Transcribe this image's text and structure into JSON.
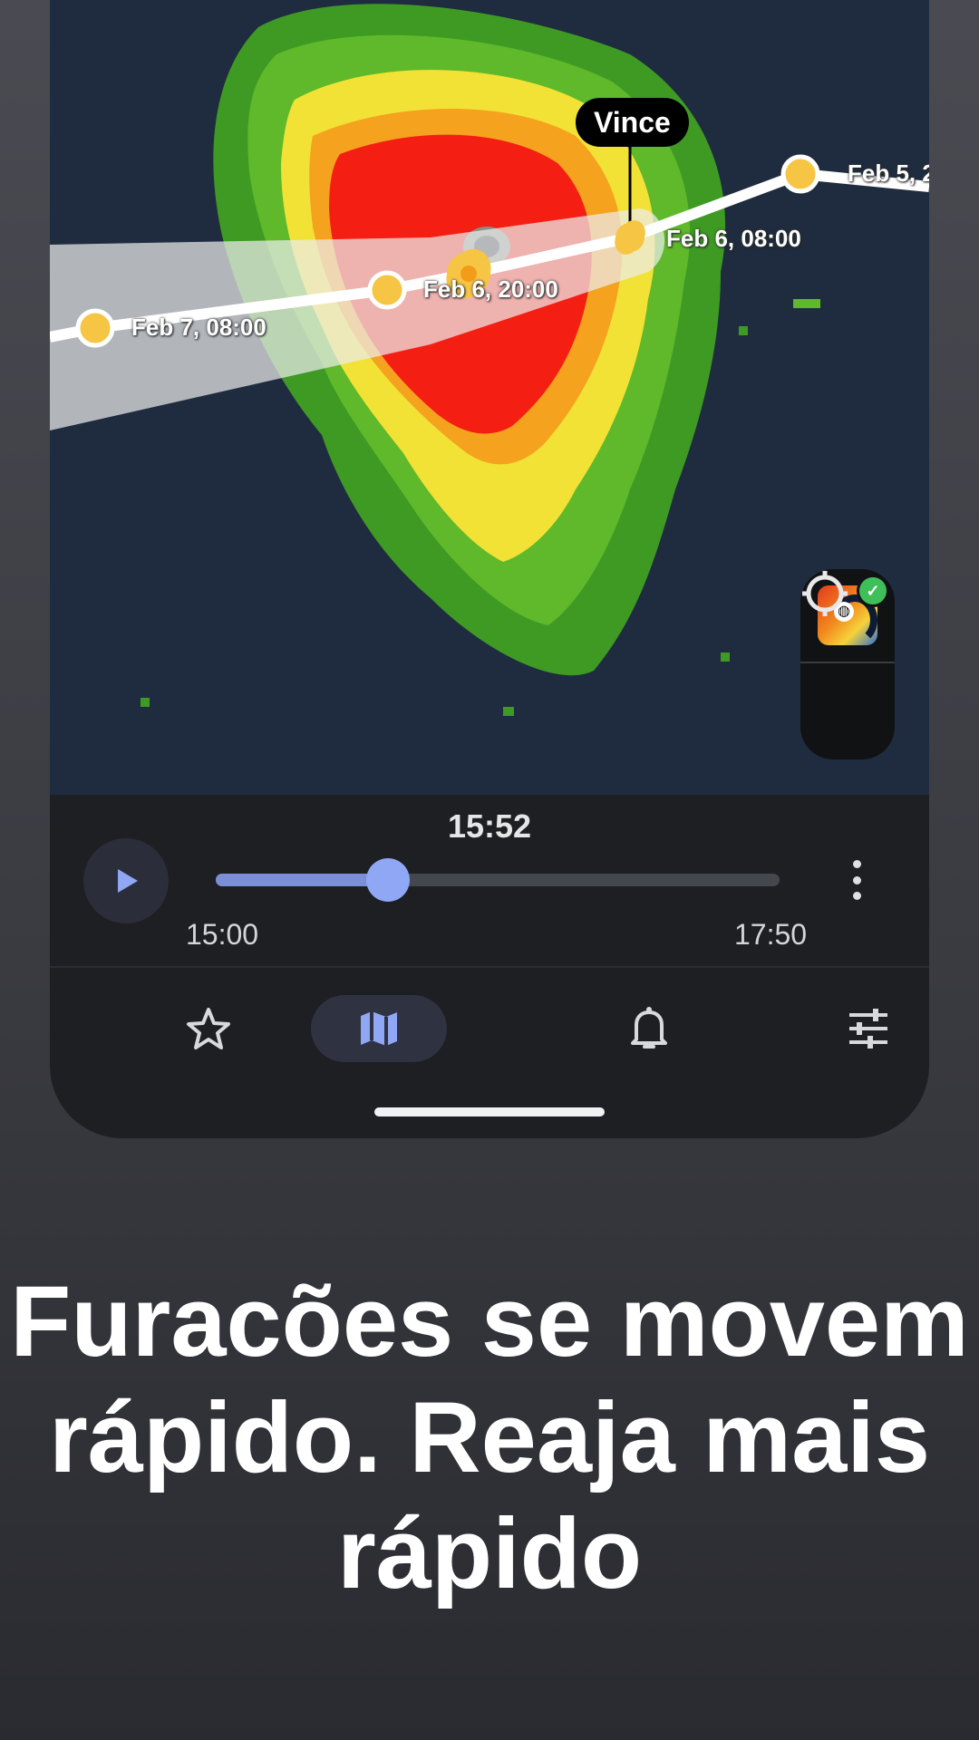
{
  "map": {
    "storm_name": "Vince",
    "track_points": [
      {
        "label": "Feb 5, 2"
      },
      {
        "label": "Feb 6, 08:00"
      },
      {
        "label": "Feb 6, 20:00"
      },
      {
        "label": "Feb 7, 08:00"
      }
    ],
    "layer_icon": "radar-layer-icon",
    "locate_icon": "crosshair-icon"
  },
  "timeline": {
    "current_time": "15:52",
    "start_time": "15:00",
    "end_time": "17:50",
    "progress": 0.306,
    "colors": {
      "fill": "#7a8fd6",
      "thumb": "#8fa7f4"
    }
  },
  "bottom_nav": {
    "items": [
      {
        "name": "favorites",
        "icon": "star-icon"
      },
      {
        "name": "map",
        "icon": "map-icon",
        "active": true
      },
      {
        "name": "alerts",
        "icon": "bell-icon"
      },
      {
        "name": "settings",
        "icon": "sliders-icon"
      }
    ]
  },
  "headline": {
    "line1": "Furacões se movem",
    "line2": "rápido. Reaja mais",
    "line3": "rápido"
  }
}
